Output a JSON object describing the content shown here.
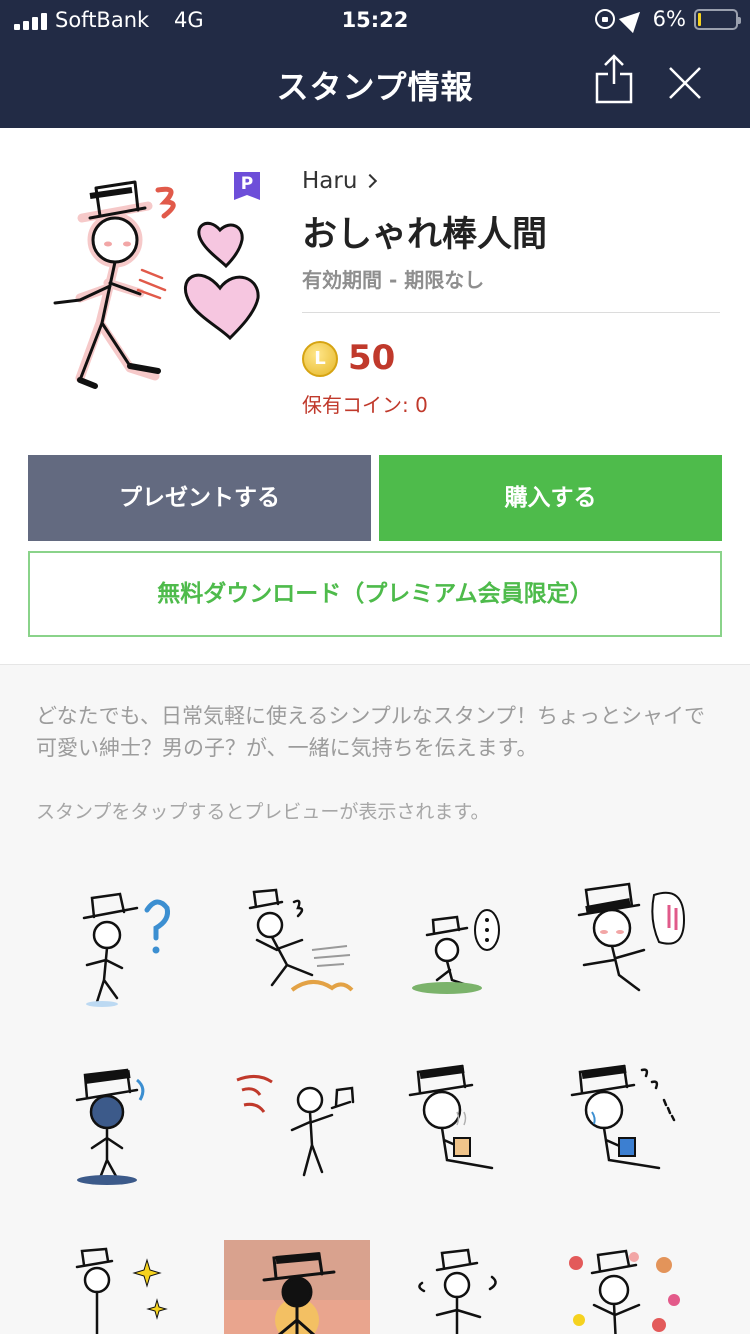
{
  "status_bar": {
    "carrier": "SoftBank",
    "network": "4G",
    "time": "15:22",
    "battery": "6%"
  },
  "nav": {
    "title": "スタンプ情報"
  },
  "product": {
    "author": "Haru",
    "title": "おしゃれ棒人間",
    "validity": "有効期間 - 期限なし",
    "price": "50",
    "coin_symbol": "L",
    "owned_coins": "保有コイン: 0",
    "premium_badge": "P"
  },
  "buttons": {
    "gift": "プレゼントする",
    "buy": "購入する",
    "free_download": "無料ダウンロード（プレミアム会員限定）"
  },
  "description": "どなたでも、日常気軽に使えるシンプルなスタンプ！ちょっとシャイで可愛い紳士？男の子？が、一緒に気持ちを伝えます。",
  "preview_hint": "スタンプをタップするとプレビューが表示されます。",
  "colors": {
    "header_bg": "#222b45",
    "buy_green": "#4ebb4b",
    "gift_gray": "#636a80",
    "price_red": "#c0392b"
  }
}
